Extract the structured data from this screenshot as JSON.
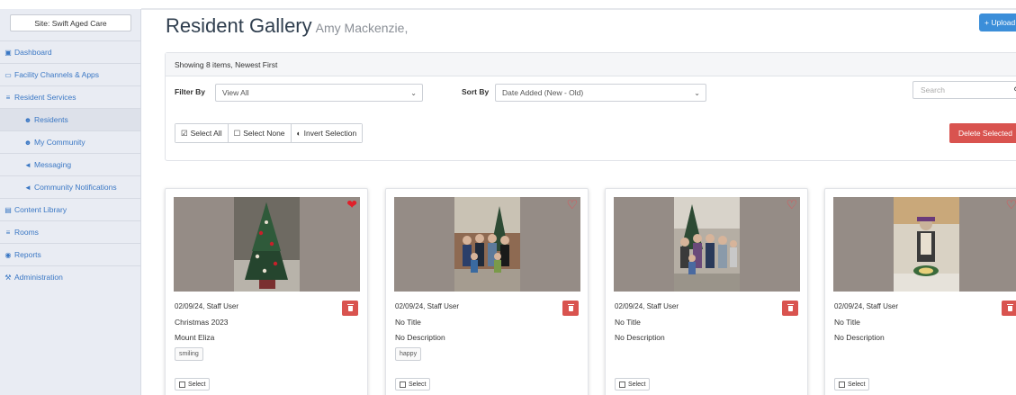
{
  "sidebar": {
    "site": "Site: Swift Aged Care",
    "items": [
      {
        "icon": "dashboard-icon",
        "glyph": "▣",
        "label": "Dashboard"
      },
      {
        "icon": "monitor-icon",
        "glyph": "▭",
        "label": "Facility Channels & Apps"
      },
      {
        "icon": "signpost-icon",
        "glyph": "≡",
        "label": "Resident Services"
      },
      {
        "icon": "users-icon",
        "glyph": "☻",
        "label": "Residents"
      },
      {
        "icon": "users-icon",
        "glyph": "☻",
        "label": "My Community"
      },
      {
        "icon": "bullhorn-icon",
        "glyph": "◄",
        "label": "Messaging"
      },
      {
        "icon": "bullhorn-icon",
        "glyph": "◄",
        "label": "Community Notifications"
      },
      {
        "icon": "list-icon",
        "glyph": "▤",
        "label": "Content Library"
      },
      {
        "icon": "signpost-icon",
        "glyph": "≡",
        "label": "Rooms"
      },
      {
        "icon": "dashboard-icon",
        "glyph": "◉",
        "label": "Reports"
      },
      {
        "icon": "wrench-icon",
        "glyph": "⚒",
        "label": "Administration"
      }
    ]
  },
  "header": {
    "title": "Resident Gallery",
    "subtitle": "Amy Mackenzie,",
    "upload_label": "+ Upload"
  },
  "filters": {
    "summary": "Showing 8 items, Newest First",
    "filter_label": "Filter By",
    "filter_value": "View All",
    "sort_label": "Sort By",
    "sort_value": "Date Added (New - Old)",
    "search_placeholder": "Search",
    "select_all": "Select All",
    "select_none": "Select None",
    "invert_selection": "Invert Selection",
    "delete_selected": "Delete Selected"
  },
  "cards": [
    {
      "meta": "02/09/24, Staff User",
      "title": "Christmas 2023",
      "description": "Mount Eliza",
      "tag": "smiling",
      "favorite": true,
      "select_label": "Select"
    },
    {
      "meta": "02/09/24, Staff User",
      "title": "No Title",
      "description": "No Description",
      "tag": "happy",
      "favorite": false,
      "select_label": "Select"
    },
    {
      "meta": "02/09/24, Staff User",
      "title": "No Title",
      "description": "No Description",
      "tag": "",
      "favorite": false,
      "select_label": "Select"
    },
    {
      "meta": "02/09/24, Staff User",
      "title": "No Title",
      "description": "No Description",
      "tag": "",
      "favorite": false,
      "select_label": "Select"
    }
  ],
  "colors": {
    "accent": "#3b8ed9",
    "danger": "#d9534f",
    "heart": "#e0202a"
  }
}
